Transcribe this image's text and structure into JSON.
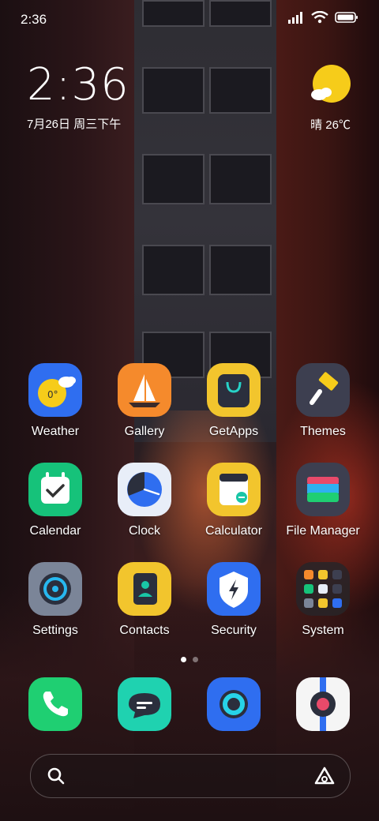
{
  "status_bar": {
    "time": "2:36",
    "icons": [
      "signal-icon",
      "wifi-icon",
      "battery-icon"
    ]
  },
  "clock_widget": {
    "time": "2:36",
    "date": "7月26日 周三下午"
  },
  "weather_widget": {
    "temp": "晴 26℃",
    "icon": "sun-cloud-icon"
  },
  "apps": [
    {
      "label": "Weather",
      "icon": "weather-icon"
    },
    {
      "label": "Gallery",
      "icon": "sailboat-icon"
    },
    {
      "label": "GetApps",
      "icon": "shopping-bag-icon"
    },
    {
      "label": "Themes",
      "icon": "brush-icon"
    },
    {
      "label": "Calendar",
      "icon": "calendar-check-icon"
    },
    {
      "label": "Clock",
      "icon": "clock-icon"
    },
    {
      "label": "Calculator",
      "icon": "calculator-icon"
    },
    {
      "label": "File Manager",
      "icon": "folder-icon"
    },
    {
      "label": "Settings",
      "icon": "settings-icon"
    },
    {
      "label": "Contacts",
      "icon": "contacts-icon"
    },
    {
      "label": "Security",
      "icon": "shield-bolt-icon"
    },
    {
      "label": "System",
      "icon": "folder-grid-icon"
    }
  ],
  "dock": [
    {
      "icon": "phone-icon"
    },
    {
      "icon": "messages-icon"
    },
    {
      "icon": "browser-icon"
    },
    {
      "icon": "camera-icon"
    }
  ],
  "page_indicator": {
    "count": 2,
    "active": 0
  },
  "search_bar": {
    "icons": [
      "search-icon",
      "assistant-icon"
    ]
  },
  "colors": {
    "weather": "#2f6ef0",
    "gallery": "#f58a2c",
    "getapps": "#f2c52d",
    "themes": "#3d3f50",
    "calendar": "#16c27a",
    "clock": "#e8eef8",
    "calculator": "#f2c52d",
    "filemanager": "#3d3f50",
    "settings": "#7b8598",
    "contacts": "#f2c52d",
    "security": "#2f6ef0",
    "phone": "#1fcf72",
    "messages": "#1fd2b0",
    "browser": "#2f6ef0",
    "camera": "#f5f5f5"
  }
}
